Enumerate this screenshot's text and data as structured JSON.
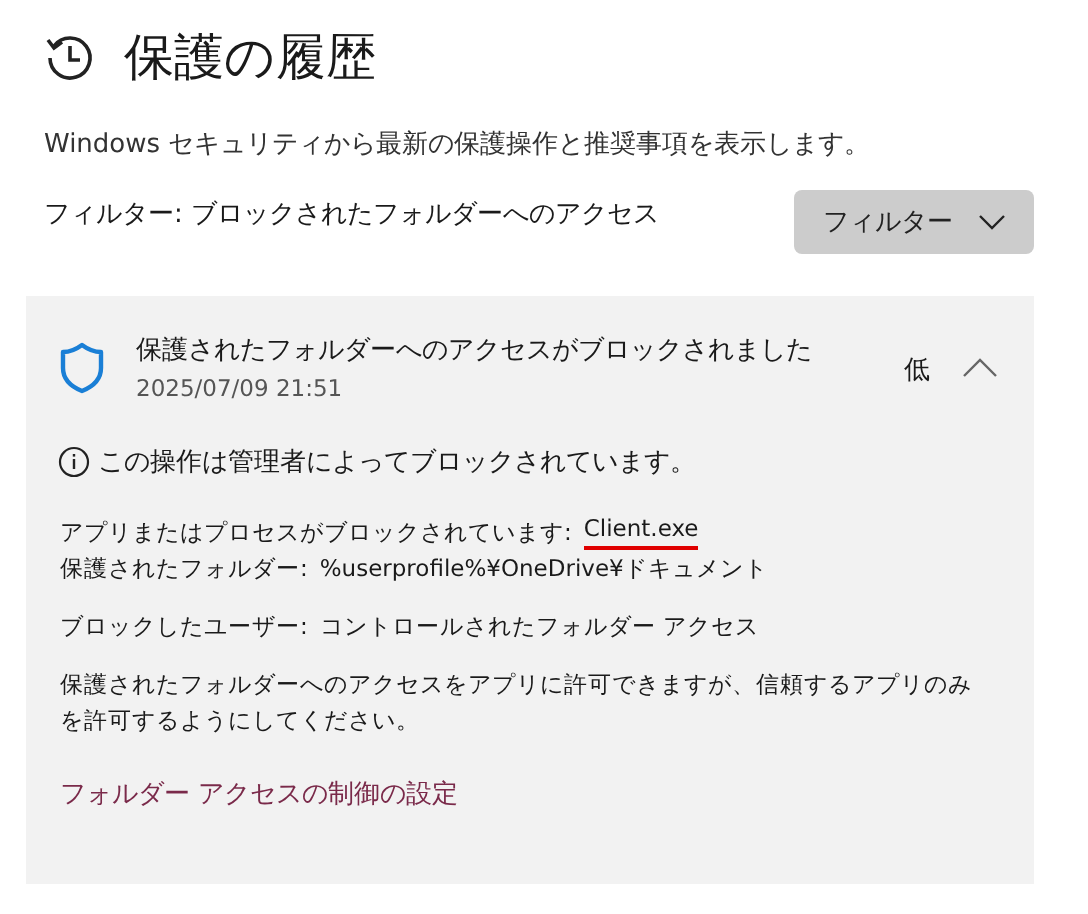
{
  "page": {
    "title": "保護の履歴",
    "description": "Windows セキュリティから最新の保護操作と推奨事項を表示します。"
  },
  "filter": {
    "label": "フィルター: ブロックされたフォルダーへのアクセス",
    "button": "フィルター"
  },
  "events": [
    {
      "title": "保護されたフォルダーへのアクセスがブロックされました",
      "time": "2025/07/09 21:51",
      "severity": "低",
      "expanded": true,
      "notice": "この操作は管理者によってブロックされています。",
      "details": [
        {
          "label": "アプリまたはプロセスがブロックされています:",
          "value": "Client.exe",
          "marked": true
        },
        {
          "label": "保護されたフォルダー:",
          "value": "%userprofile%¥OneDrive¥ドキュメント",
          "marked": false
        }
      ],
      "blocked_by": {
        "label": "ブロックしたユーザー:",
        "value": "コントロールされたフォルダー アクセス"
      },
      "advice": "保護されたフォルダーへのアクセスをアプリに許可できますが、信頼するアプリのみを許可するようにしてください。",
      "link": "フォルダー アクセスの制御の設定"
    }
  ]
}
